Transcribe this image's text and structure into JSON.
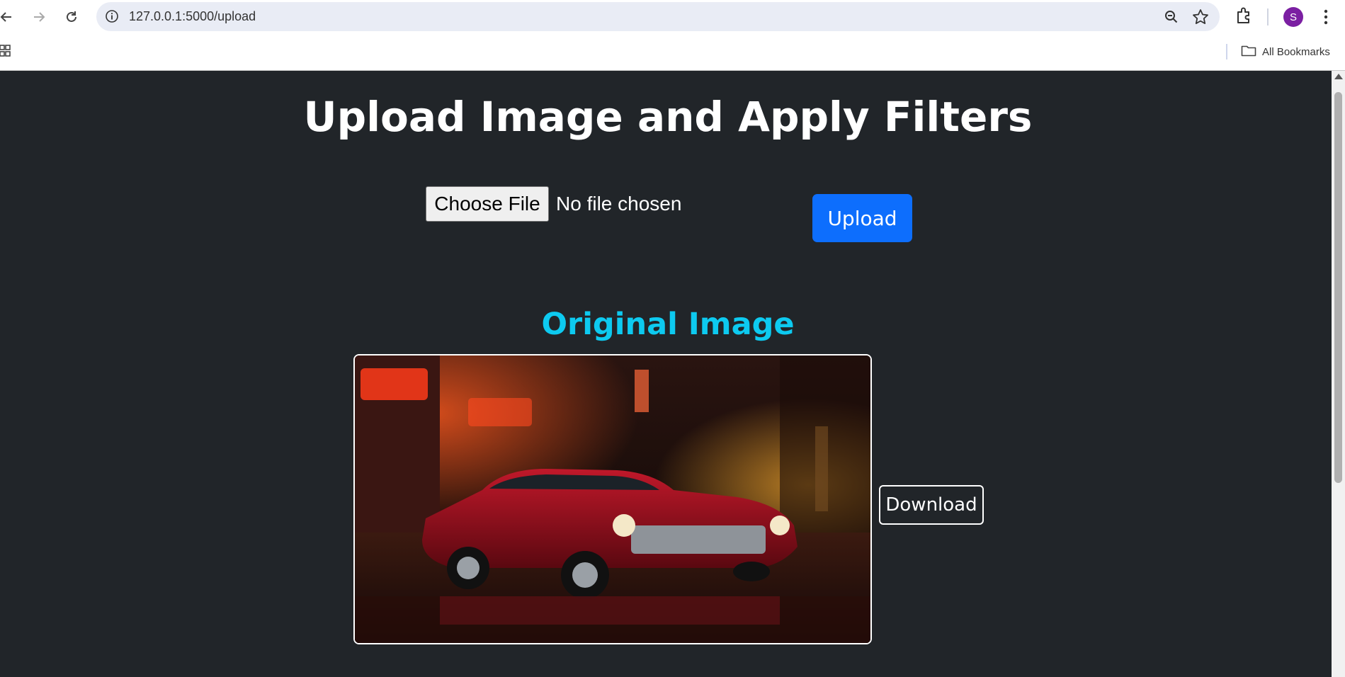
{
  "browser": {
    "url": "127.0.0.1:5000/upload",
    "profile_initial": "S",
    "bookmarks_label": "All Bookmarks"
  },
  "page": {
    "title": "Upload Image and Apply Filters",
    "file_input": {
      "button_label": "Choose File",
      "status": "No file chosen"
    },
    "upload_label": "Upload",
    "section_title": "Original Image",
    "image_alt": "Red vintage car on a neon-lit city street at night",
    "download_label": "Download"
  },
  "colors": {
    "page_background": "#212529",
    "primary_button": "#0d6efd",
    "section_title": "#0dcaf0",
    "avatar": "#7b1fa2"
  },
  "icons": [
    "back-icon",
    "forward-icon",
    "reload-icon",
    "site-info-icon",
    "zoom-icon",
    "bookmark-star-icon",
    "extensions-icon",
    "menu-icon",
    "apps-icon",
    "folder-icon"
  ]
}
